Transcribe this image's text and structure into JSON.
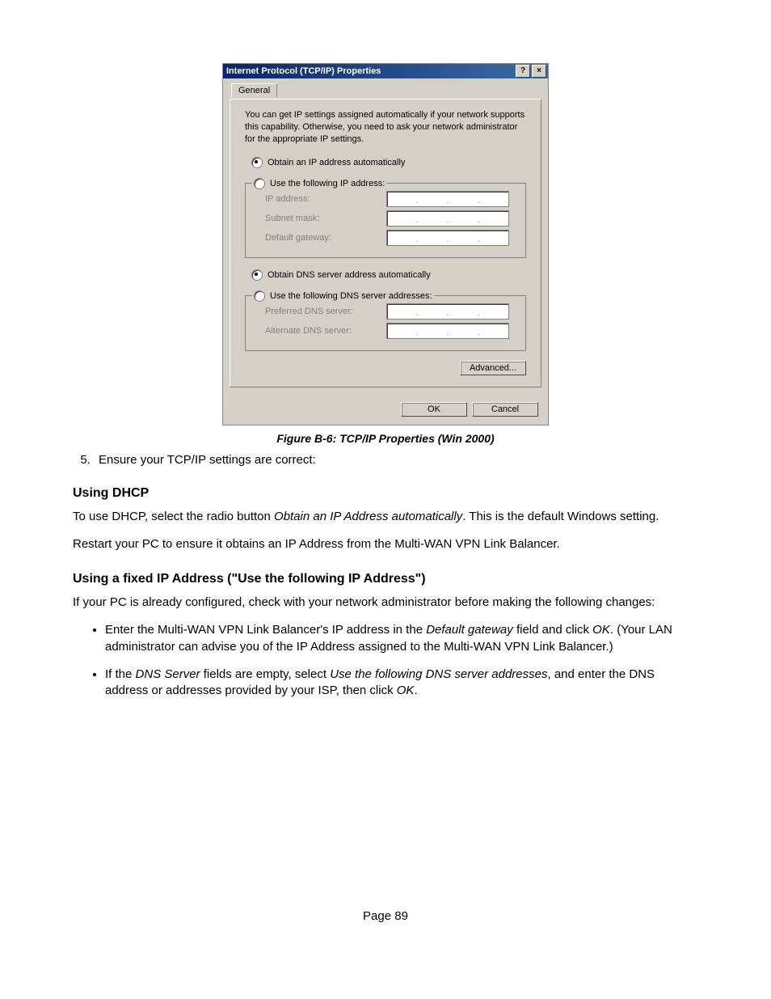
{
  "dialog": {
    "title": "Internet Protocol (TCP/IP) Properties",
    "title_icons": {
      "help": "?",
      "close": "×"
    },
    "tab": "General",
    "description": "You can get IP settings assigned automatically if your network supports this capability. Otherwise, you need to ask your network administrator for the appropriate IP settings.",
    "ip_section": {
      "auto": "Obtain an IP address automatically",
      "manual": "Use the following IP address:",
      "fields": {
        "ip": "IP address:",
        "mask": "Subnet mask:",
        "gateway": "Default gateway:"
      }
    },
    "dns_section": {
      "auto": "Obtain DNS server address automatically",
      "manual": "Use the following DNS server addresses:",
      "fields": {
        "pref": "Preferred DNS server:",
        "alt": "Alternate DNS server:"
      }
    },
    "buttons": {
      "advanced": "Advanced...",
      "ok": "OK",
      "cancel": "Cancel"
    }
  },
  "caption": "Figure B-6: TCP/IP Properties (Win 2000)",
  "step5": "Ensure your TCP/IP settings are correct:",
  "dhcp": {
    "heading": "Using DHCP",
    "p1a": "To use DHCP, select the radio button ",
    "p1em": "Obtain an IP Address automatically",
    "p1b": ". This is the default Windows setting.",
    "p2": "Restart your PC to ensure it obtains an IP Address from the Multi-WAN VPN Link Balancer."
  },
  "fixed": {
    "heading": "Using a fixed IP Address (\"Use the following IP Address\")",
    "intro": "If your PC is already configured, check with your network administrator before making the following changes:",
    "b1a": "Enter the Multi-WAN VPN Link Balancer's IP address in the ",
    "b1em1": "Default gateway",
    "b1b": " field and click ",
    "b1em2": "OK",
    "b1c": ". (Your LAN administrator can advise you of the IP Address assigned to the Multi-WAN VPN Link Balancer.)",
    "b2a": "If the ",
    "b2em1": "DNS Server",
    "b2b": " fields are empty, select ",
    "b2em2": "Use the following DNS server addresses",
    "b2c": ", and enter the DNS address or addresses provided by your ISP, then click ",
    "b2em3": "OK",
    "b2d": "."
  },
  "pagenum": "Page 89"
}
